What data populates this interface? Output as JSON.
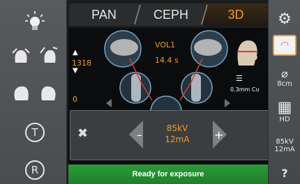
{
  "tabs": [
    {
      "label": "PAN"
    },
    {
      "label": "CEPH"
    },
    {
      "label": "3D"
    }
  ],
  "main": {
    "height_value": "1318",
    "zero_value": "0",
    "volume_label": "VOL1",
    "time_label": "14.4 s",
    "filter_label": "0.3mm Cu"
  },
  "dialog": {
    "kv": "85kV",
    "ma": "12mA"
  },
  "status": {
    "text": "Ready for exposure"
  },
  "right": {
    "fov": "8cm",
    "quality": "HD",
    "kv": "85kV",
    "ma": "12mA",
    "help": "?"
  },
  "left": {
    "t_label": "T",
    "r_label": "R"
  },
  "colors": {
    "accent": "#f39a2a",
    "status_green": "#2c9a38",
    "panel": "#4a4d50"
  }
}
